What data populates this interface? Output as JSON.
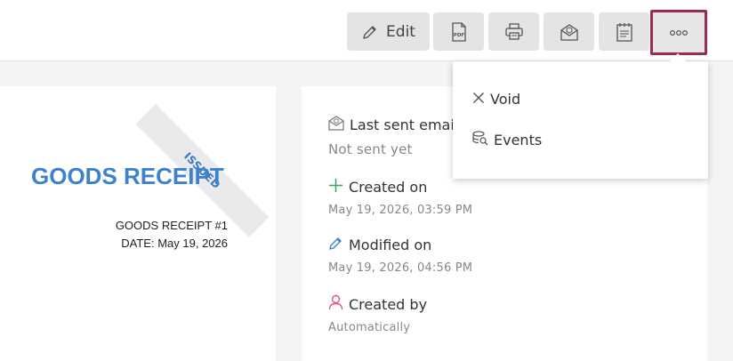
{
  "toolbar": {
    "edit_label": "Edit",
    "buttons": [
      "edit-button",
      "pdf-button",
      "print-button",
      "email-button",
      "notes-button",
      "more-button"
    ]
  },
  "document": {
    "stamp": "ISSUED",
    "title": "GOODS RECEIPT",
    "number": "GOODS RECEIPT #1",
    "date_label": "DATE:",
    "date_value": "May 19, 2026"
  },
  "info": {
    "last_sent_label": "Last sent email",
    "last_sent_value": "Not sent yet",
    "created_on_label": "Created on",
    "created_on_value": "May 19, 2026, 03:59 PM",
    "modified_on_label": "Modified on",
    "modified_on_value": "May 19, 2026, 04:56 PM",
    "created_by_label": "Created by",
    "created_by_value": "Automatically"
  },
  "more_menu": {
    "items": [
      {
        "label": "Void",
        "icon": "close-icon"
      },
      {
        "label": "Events",
        "icon": "events-icon"
      }
    ]
  },
  "colors": {
    "accent_blue": "#3e82cd",
    "highlight_border": "#9a2a56",
    "created_green": "#3aa66a",
    "created_by_pink": "#e0577f"
  }
}
